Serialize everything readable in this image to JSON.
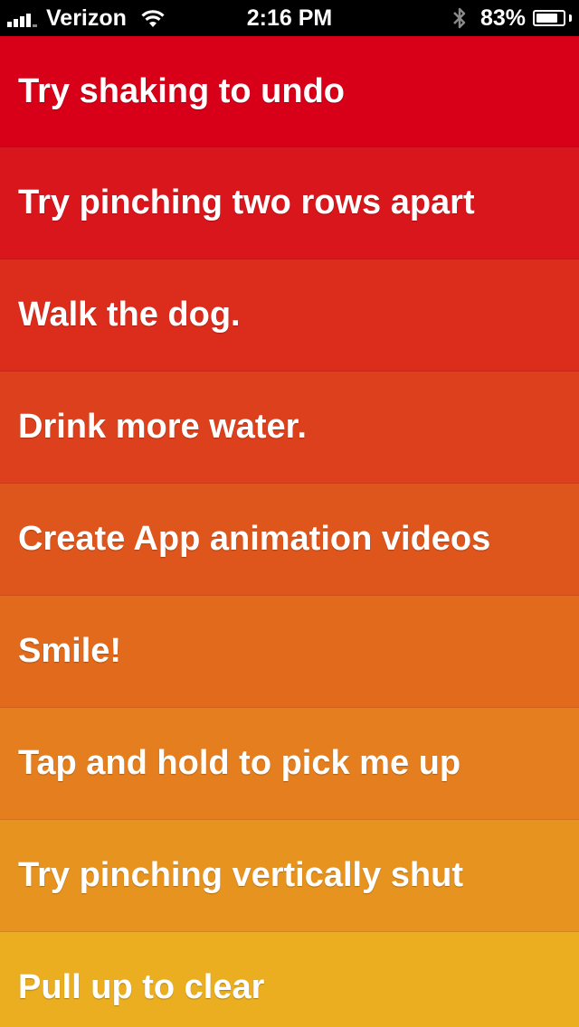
{
  "status_bar": {
    "carrier": "Verizon",
    "time": "2:16 PM",
    "battery_percent_label": "83%",
    "battery_level": 0.83,
    "icons": [
      "signal-bars-icon",
      "wifi-icon",
      "bluetooth-icon",
      "battery-icon"
    ]
  },
  "list": {
    "items": [
      {
        "label": "Try shaking to undo",
        "color": "#D80018"
      },
      {
        "label": "Try pinching two rows apart",
        "color": "#D9161C"
      },
      {
        "label": "Walk the dog.",
        "color": "#DB2C1C"
      },
      {
        "label": "Drink more water.",
        "color": "#DD401C"
      },
      {
        "label": "Create App animation videos",
        "color": "#DF561C"
      },
      {
        "label": "Smile!",
        "color": "#E16A1C"
      },
      {
        "label": "Tap and hold to pick me up",
        "color": "#E47E1E"
      },
      {
        "label": "Try pinching vertically shut",
        "color": "#E7931F"
      },
      {
        "label": "Pull up to clear",
        "color": "#EAAE20"
      }
    ]
  }
}
